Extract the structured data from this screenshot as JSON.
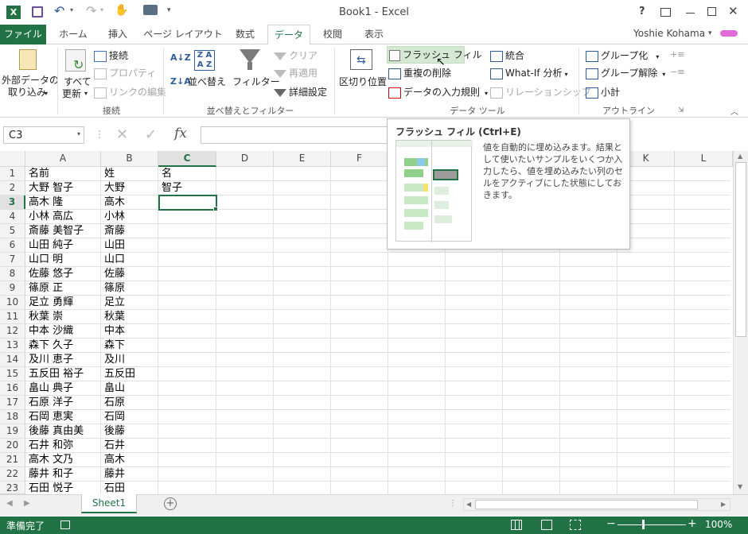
{
  "title": {
    "text": "Book1 - Excel",
    "help": "?",
    "user": "Yoshie Kohama"
  },
  "tabs": [
    {
      "label": "ファイル"
    },
    {
      "label": "ホーム"
    },
    {
      "label": "挿入"
    },
    {
      "label": "ページ レイアウト"
    },
    {
      "label": "数式"
    },
    {
      "label": "データ"
    },
    {
      "label": "校閲"
    },
    {
      "label": "表示"
    }
  ],
  "ribbon": {
    "ext_data": [
      "外部データの",
      "取り込み"
    ],
    "refresh": [
      "すべて",
      "更新"
    ],
    "connections": "接続",
    "properties": "プロパティ",
    "edit_links": "リンクの編集",
    "group_connections": "接続",
    "sort": "並べ替え",
    "filter": "フィルター",
    "clear": "クリア",
    "reapply": "再適用",
    "advanced": "詳細設定",
    "group_sort": "並べ替えとフィルター",
    "text_to_columns": "区切り位置",
    "flash_fill": "フラッシュ フィル",
    "remove_dup": "重複の削除",
    "validation": "データの入力規則",
    "consolidate": "統合",
    "whatif": "What-If 分析",
    "relations": "リレーションシップ",
    "group_tools": "データ ツール",
    "group": "グループ化",
    "ungroup": "グループ解除",
    "subtotal": "小計",
    "group_outline": "アウトライン"
  },
  "formula_bar": {
    "name_box": "C3",
    "fx": "fx",
    "value": ""
  },
  "tooltip": {
    "title": "フラッシュ フィル (Ctrl+E)",
    "body": "値を自動的に埋め込みます。結果として使いたいサンプルをいくつか入力したら、値を埋め込みたい列のセルをアクティブにした状態にしておきます。"
  },
  "columns": [
    "A",
    "B",
    "C",
    "D",
    "E",
    "F",
    "G",
    "H",
    "I",
    "J",
    "K",
    "L"
  ],
  "rows": [
    [
      "名前",
      "姓",
      "名"
    ],
    [
      "大野 智子",
      "大野",
      "智子"
    ],
    [
      "高木 隆",
      "高木",
      ""
    ],
    [
      "小林 高広",
      "小林",
      ""
    ],
    [
      "斎藤 美智子",
      "斎藤",
      ""
    ],
    [
      "山田 純子",
      "山田",
      ""
    ],
    [
      "山口 明",
      "山口",
      ""
    ],
    [
      "佐藤 悠子",
      "佐藤",
      ""
    ],
    [
      "篠原 正",
      "篠原",
      ""
    ],
    [
      "足立 勇輝",
      "足立",
      ""
    ],
    [
      "秋葉 崇",
      "秋葉",
      ""
    ],
    [
      "中本 沙織",
      "中本",
      ""
    ],
    [
      "森下 久子",
      "森下",
      ""
    ],
    [
      "及川 恵子",
      "及川",
      ""
    ],
    [
      "五反田 裕子",
      "五反田",
      ""
    ],
    [
      "畠山 典子",
      "畠山",
      ""
    ],
    [
      "石原 洋子",
      "石原",
      ""
    ],
    [
      "石岡 恵実",
      "石岡",
      ""
    ],
    [
      "後藤 真由美",
      "後藤",
      ""
    ],
    [
      "石井 和弥",
      "石井",
      ""
    ],
    [
      "高木 文乃",
      "高木",
      ""
    ],
    [
      "藤井 和子",
      "藤井",
      ""
    ],
    [
      "石田 悦子",
      "石田",
      ""
    ]
  ],
  "sheet_tab": "Sheet1",
  "status": {
    "ready": "準備完了",
    "zoom": "100%"
  },
  "colors": {
    "accent": "#217346",
    "selected_header": "#e1e1e1"
  }
}
